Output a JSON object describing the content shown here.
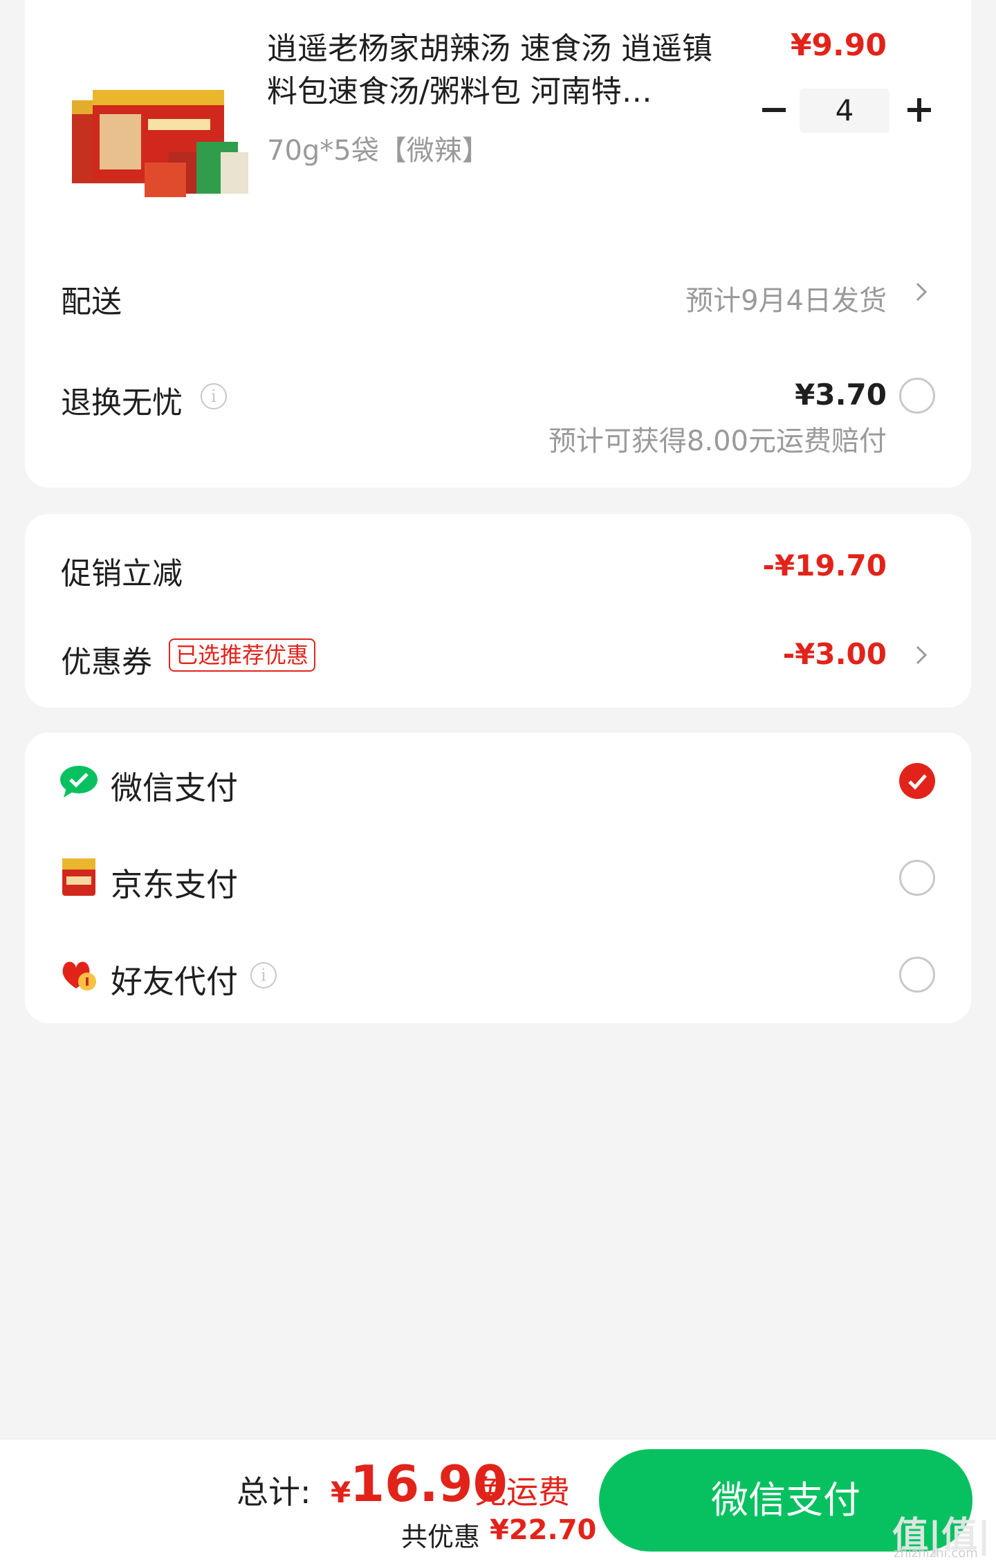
{
  "product": {
    "title": "逍遥老杨家胡辣汤 速食汤 逍遥镇料包速食汤/粥料包 河南特…",
    "spec": "70g*5袋【微辣】",
    "price": "¥9.90",
    "quantity": "4",
    "image_icon": "product-box-image"
  },
  "delivery": {
    "label": "配送",
    "value": "预计9月4日发货"
  },
  "returns": {
    "label": "退换无忧",
    "price": "¥3.70",
    "note": "预计可获得8.00元运费赔付"
  },
  "promotion": {
    "label": "促销立减",
    "amount": "-¥19.70"
  },
  "coupon": {
    "label": "优惠券",
    "tag": "已选推荐优惠",
    "amount": "-¥3.00"
  },
  "payment_methods": [
    {
      "label": "微信支付",
      "icon": "wechat-pay-icon",
      "selected": true
    },
    {
      "label": "京东支付",
      "icon": "jd-pay-icon",
      "selected": false
    },
    {
      "label": "好友代付",
      "icon": "friend-pay-icon",
      "selected": false
    }
  ],
  "summary": {
    "total_label": "总计:",
    "currency": "¥",
    "total": "16.90",
    "free_shipping": "免运费",
    "saved_label": "共优惠",
    "saved_amount": "¥22.70"
  },
  "pay_button": "微信支付",
  "watermark": {
    "main": "值|值|值",
    "sub": "zhizhizhi.com"
  },
  "colors": {
    "accent_red": "#e2231a",
    "wechat_green": "#07c160",
    "background": "#f4f4f4"
  }
}
